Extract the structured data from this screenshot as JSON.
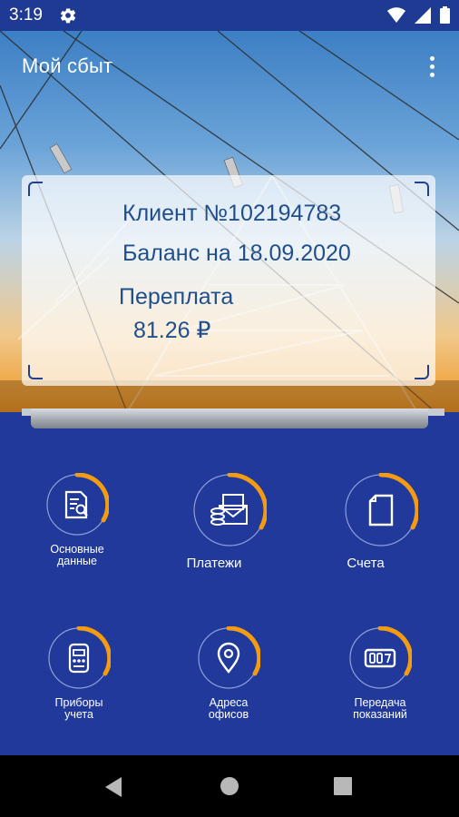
{
  "status_bar": {
    "time": "3:19",
    "icons": [
      "settings-gear-icon",
      "wifi-icon",
      "cell-signal-icon",
      "battery-icon"
    ]
  },
  "header": {
    "title": "Мой сбыт",
    "menu_icon": "more-vertical-icon"
  },
  "card": {
    "client": "Клиент №102194783",
    "balance_date": "Баланс на 18.09.2020",
    "status": "Переплата",
    "amount": "81.26 ₽"
  },
  "menu": {
    "main_data": "Основные данные",
    "payments": "Платежи",
    "invoices": "Счета",
    "meters": "Приборы учета",
    "offices": "Адреса офисов",
    "readings": "Передача показаний"
  },
  "colors": {
    "accent": "#f39c12",
    "background": "#20399b",
    "card_text": "#1f4f8c"
  },
  "nav": {
    "icons": [
      "back-icon",
      "home-icon",
      "recents-icon"
    ]
  }
}
